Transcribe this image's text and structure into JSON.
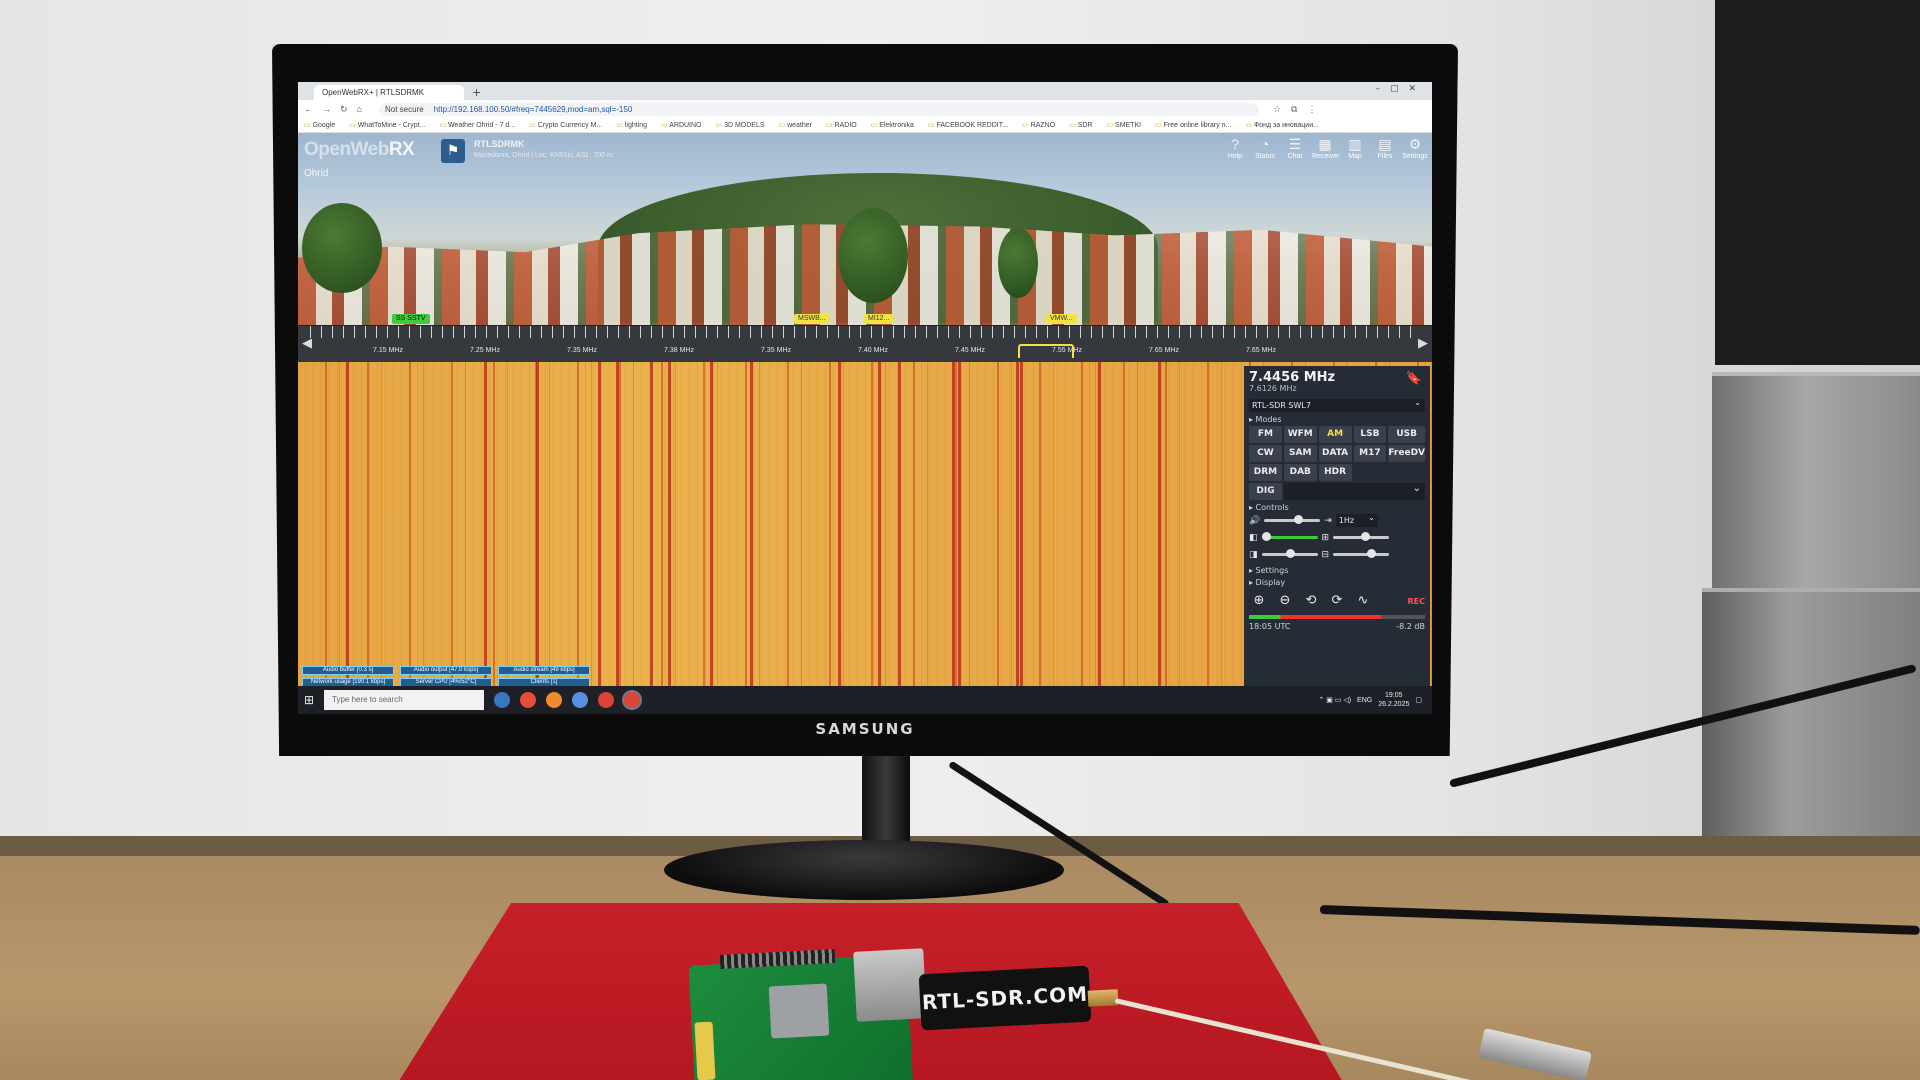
{
  "browser": {
    "tab_title": "OpenWebRX+ | RTLSDRMK",
    "not_secure": "Not secure",
    "url": "http://192.168.100.50/#freq=7445629,mod=am,sql=-150",
    "bookmarks": [
      "Google",
      "WhatToMine - Crypt...",
      "Weather Ohrid - 7 d...",
      "Crypto Currency M...",
      "lighting",
      "ARDUINO",
      "3D MODELS",
      "weather",
      "RADIO",
      "Elektronika",
      "FACEBOOK REDDIT...",
      "RAZNO",
      "SDR",
      "SMETKI",
      "Free online library n...",
      "Фонд за иновации..."
    ]
  },
  "header": {
    "logo_main": "OpenWeb",
    "logo_rx": "RX",
    "receiver_name": "RTLSDRMK",
    "receiver_location": "Macedonia, Ohrid | Loc: KN01js, ASL: 700 m",
    "city_label": "Ohrid",
    "nav": [
      {
        "label": "Help",
        "icon": "help-icon"
      },
      {
        "label": "Status",
        "icon": "status-icon"
      },
      {
        "label": "Chat",
        "icon": "chat-icon"
      },
      {
        "label": "Receiver",
        "icon": "receiver-icon"
      },
      {
        "label": "Map",
        "icon": "map-icon"
      },
      {
        "label": "Files",
        "icon": "files-icon"
      },
      {
        "label": "Settings",
        "icon": "settings-icon"
      }
    ]
  },
  "spectrum": {
    "bookmarks": [
      "SS SSTV",
      "MSWB...",
      "MI12...",
      "VMW..."
    ],
    "tick_labels": [
      "7.15 MHz",
      "7.25 MHz",
      "7.35 MHz",
      "7.38 MHz",
      "7.35 MHz",
      "7.40 MHz",
      "7.45 MHz",
      "7.55 MHz",
      "7.65 MHz",
      "7.65 MHz"
    ]
  },
  "panel": {
    "frequency": "7.4456 MHz",
    "sub_frequency": "7.6126 MHz",
    "profile": "RTL-SDR SWL7",
    "modes_title": "▸ Modes",
    "modes": [
      "FM",
      "WFM",
      "AM",
      "LSB",
      "USB",
      "CW",
      "SAM",
      "DATA",
      "M17",
      "FreeDV",
      "DRM",
      "DAB",
      "HDR"
    ],
    "active_mode": "AM",
    "dig_label": "DIG",
    "controls_title": "▸ Controls",
    "step": "1Hz",
    "settings_title": "▸ Settings",
    "display_title": "▸ Display",
    "rec_label": "REC",
    "utc_time": "18:05 UTC",
    "signal_level": "-8.2 dB"
  },
  "status": [
    "Audio buffer [0.3 s]",
    "Audio output [47.0 ksps]",
    "Audio stream [49 kbps]",
    "Network usage [190.1 kbps]",
    "Server CPU [4%/52°C]",
    "Clients [1]"
  ],
  "taskbar": {
    "search_placeholder": "Type here to search",
    "language": "ENG",
    "time": "19:05",
    "date": "26.2.2025"
  },
  "monitor": {
    "brand": "SAMSUNG"
  },
  "hardware": {
    "sdr_label": "RTL-SDR.COM"
  }
}
